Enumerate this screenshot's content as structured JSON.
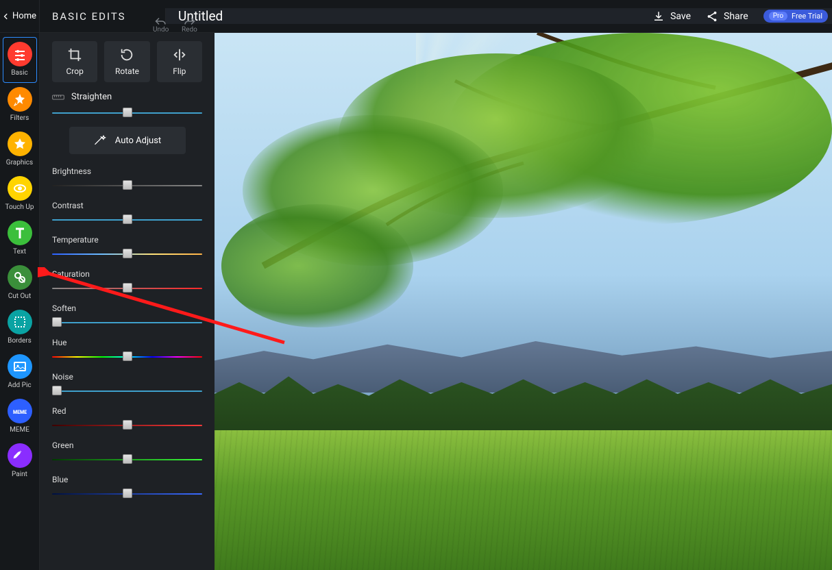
{
  "header": {
    "home": "Home",
    "panel_title": "BASIC EDITS",
    "undo": "Undo",
    "redo": "Redo",
    "doc_title": "Untitled",
    "save": "Save",
    "share": "Share",
    "pro_label": "Pro",
    "pro_trial": "Free Trial"
  },
  "sidebar": {
    "items": [
      {
        "id": "basic",
        "label": "Basic",
        "color": "#ff3b2f",
        "active": true
      },
      {
        "id": "filters",
        "label": "Filters",
        "color": "#ff8a00"
      },
      {
        "id": "graphics",
        "label": "Graphics",
        "color": "#ffb300"
      },
      {
        "id": "touchup",
        "label": "Touch Up",
        "color": "#ffd400"
      },
      {
        "id": "text",
        "label": "Text",
        "color": "#3bbf3b"
      },
      {
        "id": "cutout",
        "label": "Cut Out",
        "color": "#3a8f3a"
      },
      {
        "id": "borders",
        "label": "Borders",
        "color": "#0aa3a3"
      },
      {
        "id": "addpic",
        "label": "Add Pic",
        "color": "#1e96ff"
      },
      {
        "id": "meme",
        "label": "MEME",
        "color": "#2d5fff"
      },
      {
        "id": "paint",
        "label": "Paint",
        "color": "#8a2dff"
      }
    ]
  },
  "panel": {
    "buttons": {
      "crop": "Crop",
      "rotate": "Rotate",
      "flip": "Flip"
    },
    "straighten": "Straighten",
    "auto_adjust": "Auto Adjust",
    "sliders": [
      {
        "id": "brightness",
        "label": "Brightness",
        "pos": 50,
        "track": "gray"
      },
      {
        "id": "contrast",
        "label": "Contrast",
        "pos": 50,
        "track": "blue"
      },
      {
        "id": "temperature",
        "label": "Temperature",
        "pos": 50,
        "track": "temp"
      },
      {
        "id": "saturation",
        "label": "Saturation",
        "pos": 50,
        "track": "sat"
      },
      {
        "id": "soften",
        "label": "Soften",
        "pos": 3,
        "track": "blue"
      },
      {
        "id": "hue",
        "label": "Hue",
        "pos": 50,
        "track": "hue"
      },
      {
        "id": "noise",
        "label": "Noise",
        "pos": 3,
        "track": "blue"
      },
      {
        "id": "red",
        "label": "Red",
        "pos": 50,
        "track": "red"
      },
      {
        "id": "green",
        "label": "Green",
        "pos": 50,
        "track": "green"
      },
      {
        "id": "blue",
        "label": "Blue",
        "pos": 50,
        "track": "bluec"
      }
    ]
  },
  "annotation": {
    "arrow_target": "cutout"
  }
}
